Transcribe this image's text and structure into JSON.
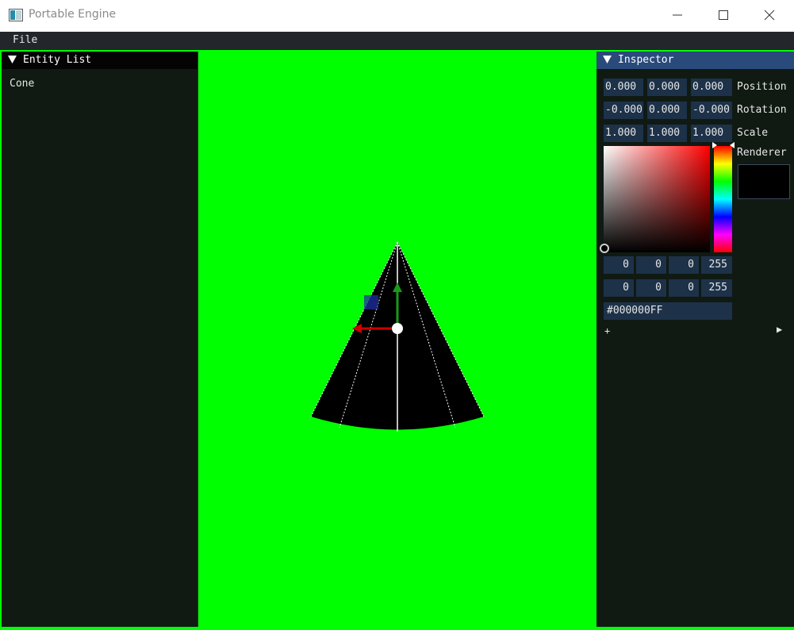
{
  "window": {
    "title": "Portable Engine"
  },
  "menu": {
    "items": [
      {
        "label": "File"
      }
    ]
  },
  "entity_list": {
    "title": "Entity List",
    "items": [
      {
        "label": "Cone"
      }
    ]
  },
  "inspector": {
    "title": "Inspector",
    "position": {
      "label": "Position",
      "values": [
        "0.000",
        "0.000",
        "0.000"
      ]
    },
    "rotation": {
      "label": "Rotation",
      "values": [
        "-0.000",
        "0.000",
        "-0.000"
      ]
    },
    "scale": {
      "label": "Scale",
      "values": [
        "1.000",
        "1.000",
        "1.000"
      ]
    },
    "renderer": {
      "label": "Renderer",
      "color": "#000000"
    },
    "rgba_row1": [
      "0",
      "0",
      "0",
      "255"
    ],
    "rgba_row2": [
      "0",
      "0",
      "0",
      "255"
    ],
    "hex": "#000000FF",
    "add_label": "+",
    "play_label": "▶"
  },
  "colors": {
    "viewport_bg": "#00ff00",
    "panel_bg": "#101a13",
    "inspector_header": "#294a7a",
    "field_bg": "#1d3249",
    "gizmo_x": "#cc0000",
    "gizmo_y": "#1a9a1a",
    "gizmo_z": "#1f2fa0"
  }
}
